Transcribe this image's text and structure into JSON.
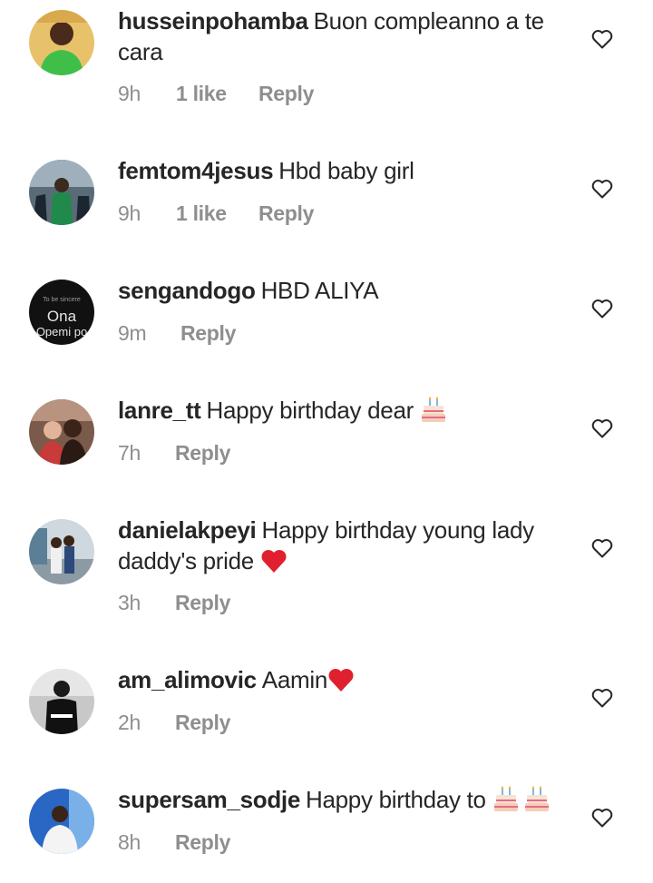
{
  "comments": [
    {
      "username": "husseinpohamba",
      "text": "Buon compleanno a te cara",
      "time": "9h",
      "likes": "1 like",
      "reply": "Reply"
    },
    {
      "username": "femtom4jesus",
      "text": "Hbd baby girl",
      "time": "9h",
      "likes": "1 like",
      "reply": "Reply"
    },
    {
      "username": "sengandogo",
      "text": "HBD ALIYA",
      "time": "9m",
      "reply": "Reply",
      "avatar_text": [
        "To be sincere",
        "Ona",
        "Opemi po"
      ]
    },
    {
      "username": "lanre_tt",
      "text": "Happy birthday dear",
      "time": "7h",
      "reply": "Reply",
      "emoji": [
        "birthday-cake"
      ]
    },
    {
      "username": "danielakpeyi",
      "text": "Happy birthday young lady daddy's pride",
      "time": "3h",
      "reply": "Reply",
      "emoji": [
        "red-heart"
      ]
    },
    {
      "username": "am_alimovic",
      "text": "Aamin",
      "time": "2h",
      "reply": "Reply",
      "emoji": [
        "red-heart"
      ]
    },
    {
      "username": "supersam_sodje",
      "text": "Happy birthday to",
      "time": "8h",
      "reply": "Reply",
      "emoji": [
        "birthday-cake",
        "birthday-cake"
      ]
    }
  ],
  "icons": {
    "like": "heart-outline-icon"
  },
  "colors": {
    "text": "#262626",
    "muted": "#8e8e8e",
    "heart_emoji": "#e0202e"
  }
}
